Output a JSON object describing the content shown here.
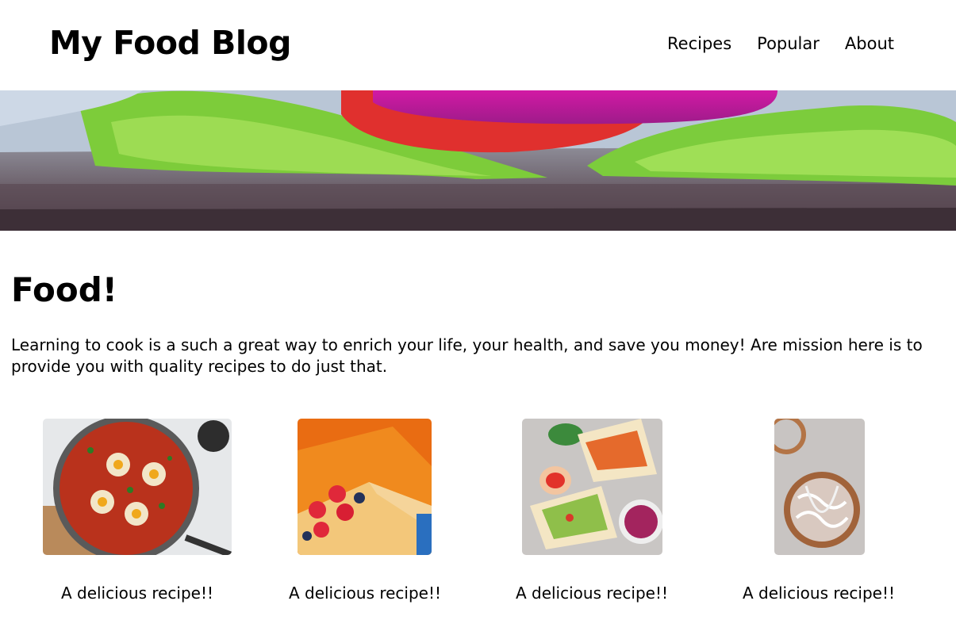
{
  "header": {
    "site_title": "My Food Blog",
    "nav": [
      {
        "label": "Recipes"
      },
      {
        "label": "Popular"
      },
      {
        "label": "About"
      }
    ]
  },
  "main": {
    "title": "Food!",
    "intro": "Learning to cook is a such a great way to enrich your life, your health, and save you money! Are mission here is to provide you with quality recipes to do just that."
  },
  "recipes": [
    {
      "caption": "A delicious recipe!!"
    },
    {
      "caption": "A delicious recipe!!"
    },
    {
      "caption": "A delicious recipe!!"
    },
    {
      "caption": "A delicious recipe!!"
    }
  ]
}
